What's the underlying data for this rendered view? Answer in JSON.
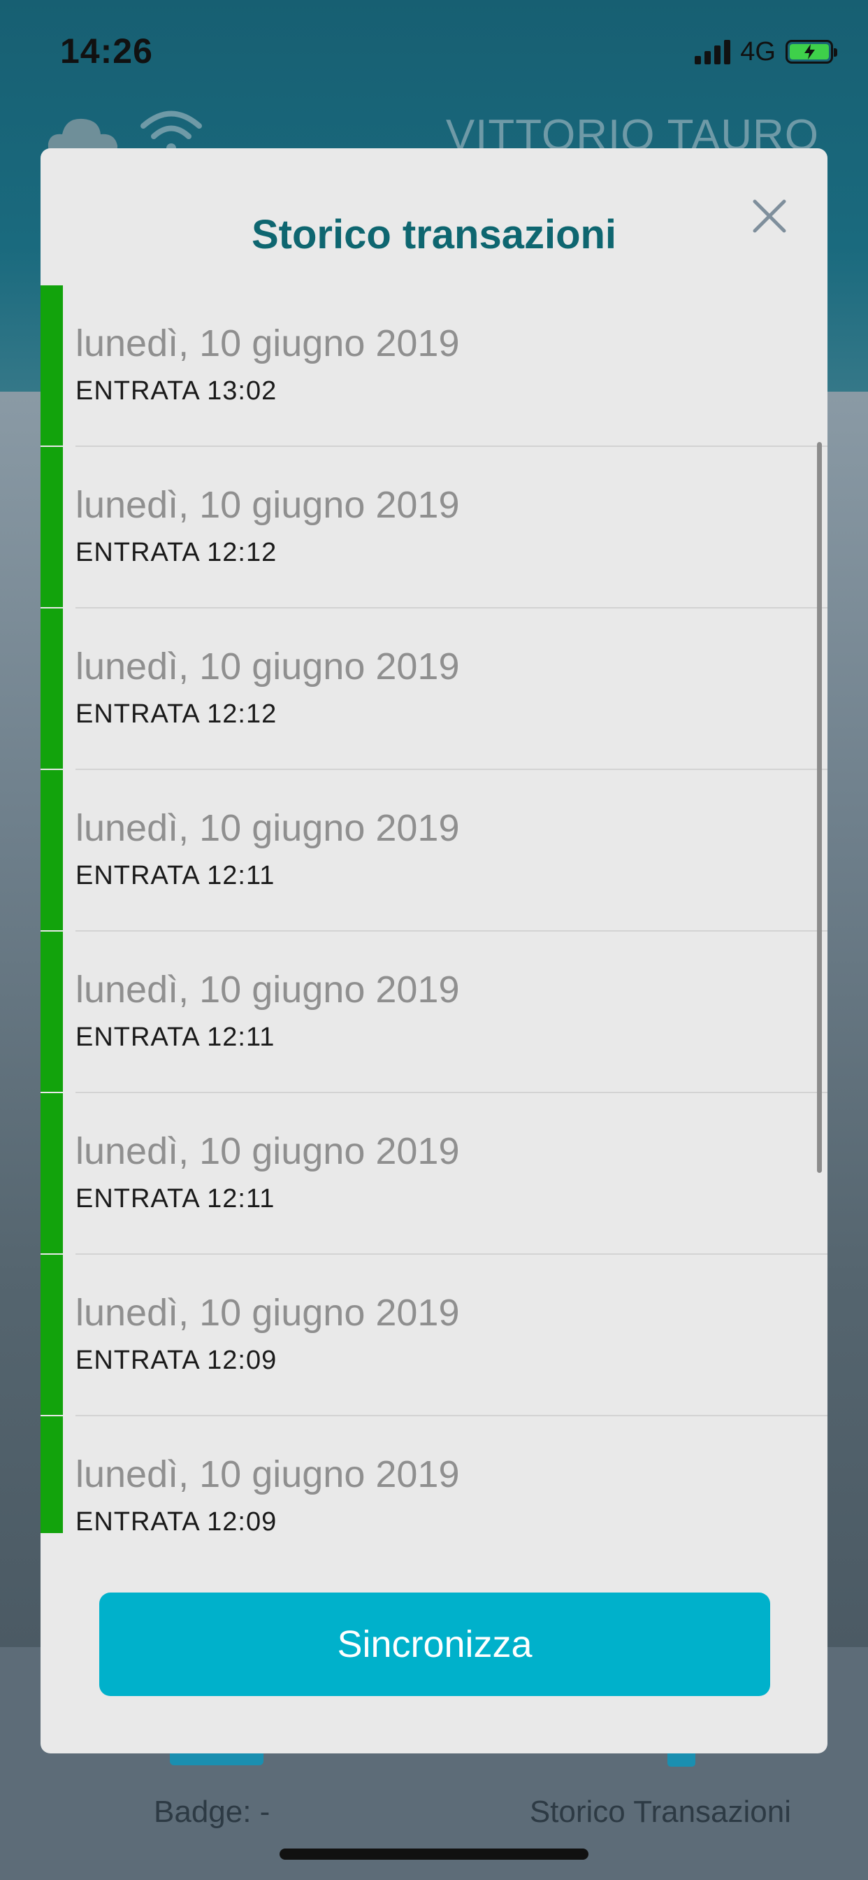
{
  "status_bar": {
    "time": "14:26",
    "network": "4G"
  },
  "background_app": {
    "user_name": "VITTORIO TAURO",
    "badge_label": "Badge: -",
    "history_label": "Storico Transazioni"
  },
  "modal": {
    "title": "Storico transazioni",
    "close_icon": "close-icon",
    "sync_button_label": "Sincronizza",
    "entry_color": "#12a30c",
    "transactions": [
      {
        "date": "lunedì, 10 giugno 2019",
        "detail": "ENTRATA 13:02"
      },
      {
        "date": "lunedì, 10 giugno 2019",
        "detail": "ENTRATA 12:12"
      },
      {
        "date": "lunedì, 10 giugno 2019",
        "detail": "ENTRATA 12:12"
      },
      {
        "date": "lunedì, 10 giugno 2019",
        "detail": "ENTRATA 12:11"
      },
      {
        "date": "lunedì, 10 giugno 2019",
        "detail": "ENTRATA 12:11"
      },
      {
        "date": "lunedì, 10 giugno 2019",
        "detail": "ENTRATA 12:11"
      },
      {
        "date": "lunedì, 10 giugno 2019",
        "detail": "ENTRATA 12:09"
      },
      {
        "date": "lunedì, 10 giugno 2019",
        "detail": "ENTRATA 12:09"
      }
    ]
  }
}
